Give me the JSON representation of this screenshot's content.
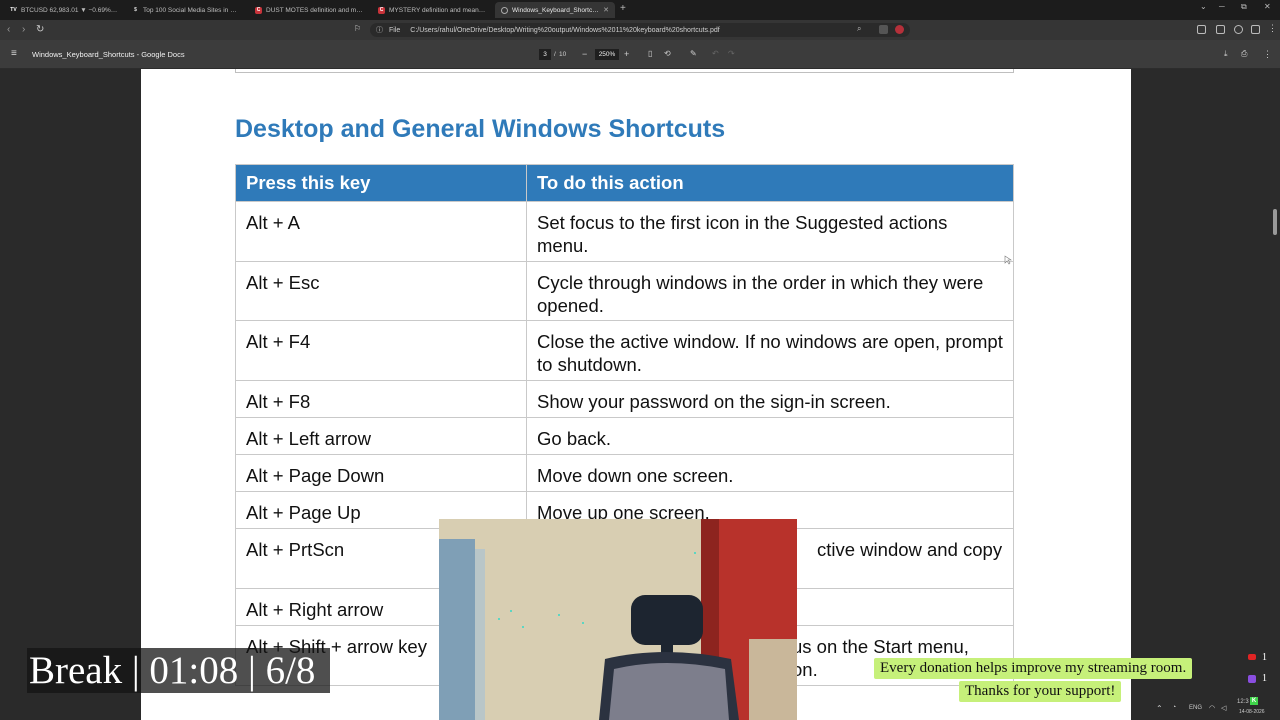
{
  "browser": {
    "tabs": [
      {
        "title": "BTCUSD 62,983.01 ▼ −0.69% Strategy",
        "icon": "tradingview-icon",
        "fav_color": "#1c1c1c",
        "fav_text": "TV"
      },
      {
        "title": "Top 100 Social Media Sites in 2026 (B",
        "icon": "dollar-icon",
        "fav_color": "#1c1c1c",
        "fav_text": "$"
      },
      {
        "title": "DUST MOTES definition and meaning",
        "icon": "collins-icon",
        "fav_color": "#c8333a",
        "fav_text": "C"
      },
      {
        "title": "MYSTERY definition and meaning | C",
        "icon": "collins-icon",
        "fav_color": "#c8333a",
        "fav_text": "C"
      },
      {
        "title": "Windows_Keyboard_Shortcuts -",
        "icon": "pdf-icon",
        "fav_color": "#5a5a5a",
        "fav_text": ""
      }
    ],
    "new_tab": "+",
    "window_controls": [
      "⌄",
      "─",
      "⧉",
      "✕"
    ],
    "address": {
      "scheme_label": "File",
      "url": "C:/Users/rahul/OneDrive/Desktop/Writing%20output/Windows%2011%20keyboard%20shortcuts.pdf"
    }
  },
  "pdf": {
    "doc_title": "Windows_Keyboard_Shortcuts - Google Docs",
    "current_page": "3",
    "separator": "/",
    "total_pages": "10",
    "zoom": "250%"
  },
  "document": {
    "heading": "Desktop and General Windows Shortcuts",
    "table": {
      "headers": [
        "Press this key",
        "To do this action"
      ],
      "rows": [
        {
          "key": "Alt + A",
          "action": "Set focus to the first icon in the Suggested actions menu."
        },
        {
          "key": "Alt + Esc",
          "action": "Cycle through windows in the order in which they were opened."
        },
        {
          "key": "Alt + F4",
          "action": "Close the active window. If no windows are open, prompt to shutdown."
        },
        {
          "key": "Alt + F8",
          "action": "Show your password on the sign-in screen."
        },
        {
          "key": "Alt + Left arrow",
          "action": "Go back."
        },
        {
          "key": "Alt + Page Down",
          "action": "Move down one screen."
        },
        {
          "key": "Alt + Page Up",
          "action": "Move up one screen."
        },
        {
          "key": "Alt + PrtScn",
          "action": "ctive window and copy"
        },
        {
          "key": "Alt + Right arrow",
          "action": ""
        },
        {
          "key": "Alt + Shift + arrow key",
          "action": "us on the Start menu,"
        }
      ],
      "partial_line": "on."
    }
  },
  "overlay": {
    "break_text": "Break | 01:08 | 6/8",
    "donation_line1": "Every donation helps improve my streaming room.",
    "donation_line2": "Thanks for your support!",
    "youtube_count": "1",
    "twitch_count": "1"
  },
  "taskbar": {
    "language": "ENG",
    "time": "12:3",
    "date": "14-08-2026"
  }
}
